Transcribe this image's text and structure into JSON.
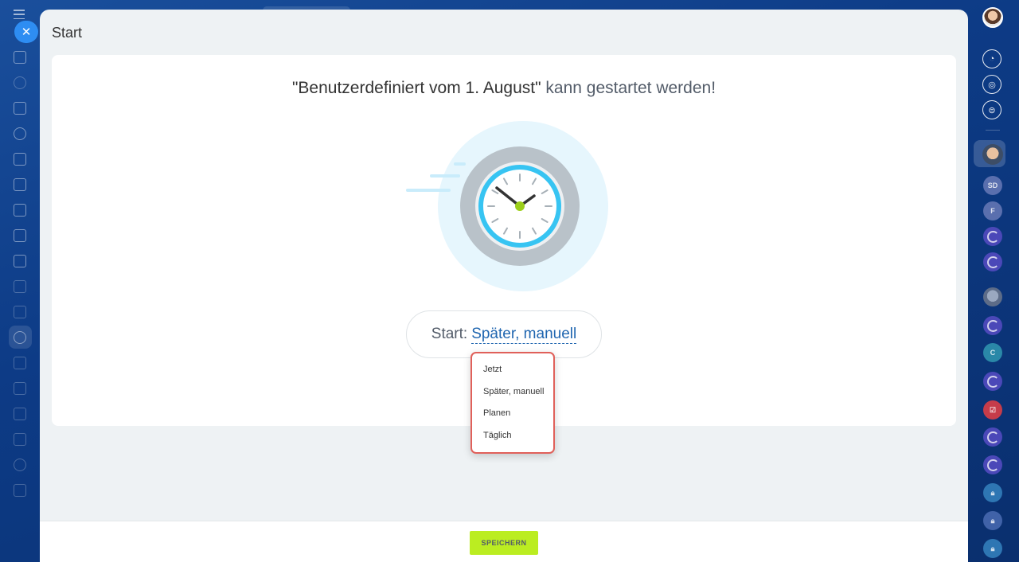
{
  "panel": {
    "title": "Start"
  },
  "headline": {
    "name": "\"Benutzerdefiniert vom 1. August\"",
    "suffix": " kann gestartet werden!"
  },
  "start_selector": {
    "label": "Start:",
    "value": "Später, manuell"
  },
  "dropdown": {
    "items": [
      "Jetzt",
      "Später, manuell",
      "Planen",
      "Täglich"
    ]
  },
  "footer": {
    "save_label": "SPEICHERN"
  },
  "right_sidebar": {
    "chat_initials_1": "SD",
    "chat_initials_2": "F",
    "chat_initials_3": "C"
  },
  "colors": {
    "accent": "#2e8df2",
    "save_button": "#bbed21",
    "link": "#2066b0",
    "dropdown_border": "#e0605a"
  },
  "icons": {
    "left_nav": [
      "home-icon",
      "pulse-icon",
      "feed-icon",
      "users-icon",
      "document-icon",
      "crm-icon",
      "workgroup-icon",
      "tasks-icon",
      "chat-icon",
      "analytics-icon",
      "cart-icon",
      "marketing-icon",
      "database-icon",
      "filter-icon",
      "sites-icon",
      "contact-center-icon",
      "automation-icon",
      "list-icon"
    ],
    "right_top": [
      "bell-icon",
      "openlines-icon",
      "search-chat-icon"
    ]
  }
}
